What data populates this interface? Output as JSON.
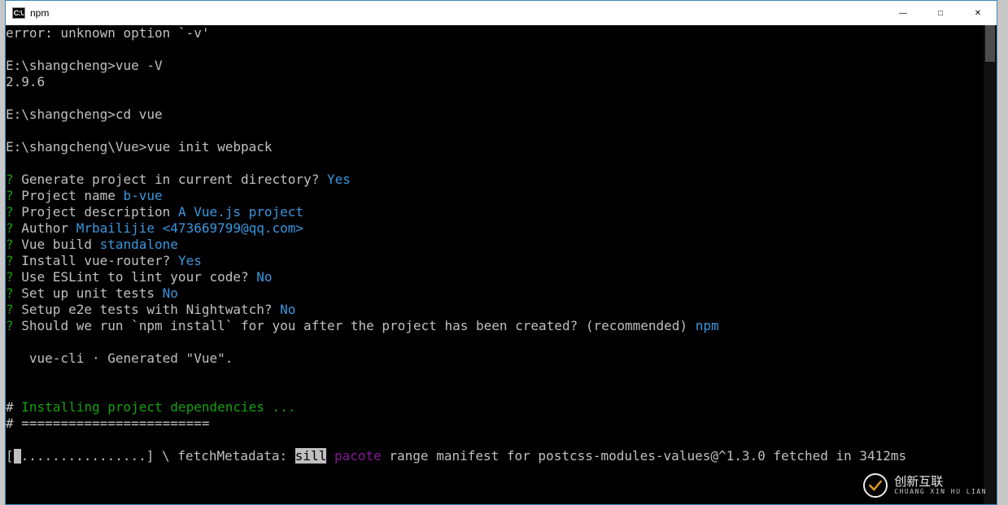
{
  "window": {
    "title": "npm",
    "icon_label": "C:\\."
  },
  "controls": {
    "minimize": "—",
    "maximize": "□",
    "close": "✕"
  },
  "term": {
    "l1": "error: unknown option `-v'",
    "l2a": "E:\\shangcheng>",
    "l2b": "vue -V",
    "l3": "2.9.6",
    "l4a": "E:\\shangcheng>",
    "l4b": "cd vue",
    "l5a": "E:\\shangcheng\\Vue>",
    "l5b": "vue init webpack",
    "q": "?",
    "p1": " Generate project in current directory? ",
    "p1a": "Yes",
    "p2": " Project name ",
    "p2a": "b-vue",
    "p3": " Project description ",
    "p3a": "A Vue.js project",
    "p4": " Author ",
    "p4a": "Mrbailijie <473669799@qq.com>",
    "p5": " Vue build ",
    "p5a": "standalone",
    "p6": " Install vue-router? ",
    "p6a": "Yes",
    "p7": " Use ESLint to lint your code? ",
    "p7a": "No",
    "p8": " Set up unit tests ",
    "p8a": "No",
    "p9": " Setup e2e tests with Nightwatch? ",
    "p9a": "No",
    "p10": " Should we run `npm install` for you after the project has been created? (recommended) ",
    "p10a": "npm",
    "gen": "   vue-cli · Generated \"Vue\".",
    "hash": "#",
    "inst": " Installing project dependencies ...",
    "sep": " ========================",
    "fetch1": "[",
    "fetch_dots": "................] \\ fetchMetadata: ",
    "fetch_sill": "sill",
    "fetch_sp": " ",
    "fetch_pacote": "pacote",
    "fetch2": " range manifest for postcss-modules-values@^1.3.0 fetched in 3412ms"
  },
  "watermark": {
    "brand": "创新互联",
    "sub": "CHUANG XIN HU LIAN"
  }
}
